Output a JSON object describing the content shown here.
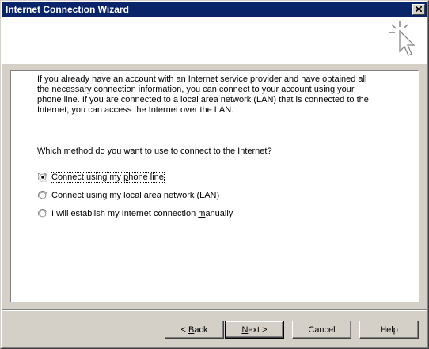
{
  "window": {
    "title": "Internet Connection Wizard"
  },
  "content": {
    "intro": "If you already have an account with an Internet service provider and have obtained all the necessary connection information, you can connect to your account using your phone line. If you are connected to a local area network (LAN) that is connected to the Internet, you can access the Internet over the LAN.",
    "question": "Which method do you want to use to connect to the Internet?",
    "options": [
      {
        "pre": "Connect using my ",
        "key": "p",
        "post": "hone line",
        "selected": true
      },
      {
        "pre": "Connect using my ",
        "key": "l",
        "post": "ocal area network (LAN)",
        "selected": false
      },
      {
        "pre": "I will establish my Internet connection ",
        "key": "m",
        "post": "anually",
        "selected": false
      }
    ]
  },
  "buttons": {
    "back": {
      "pre": "< ",
      "key": "B",
      "post": "ack"
    },
    "next": {
      "pre": "",
      "key": "N",
      "post": "ext >"
    },
    "cancel": "Cancel",
    "help": "Help"
  }
}
